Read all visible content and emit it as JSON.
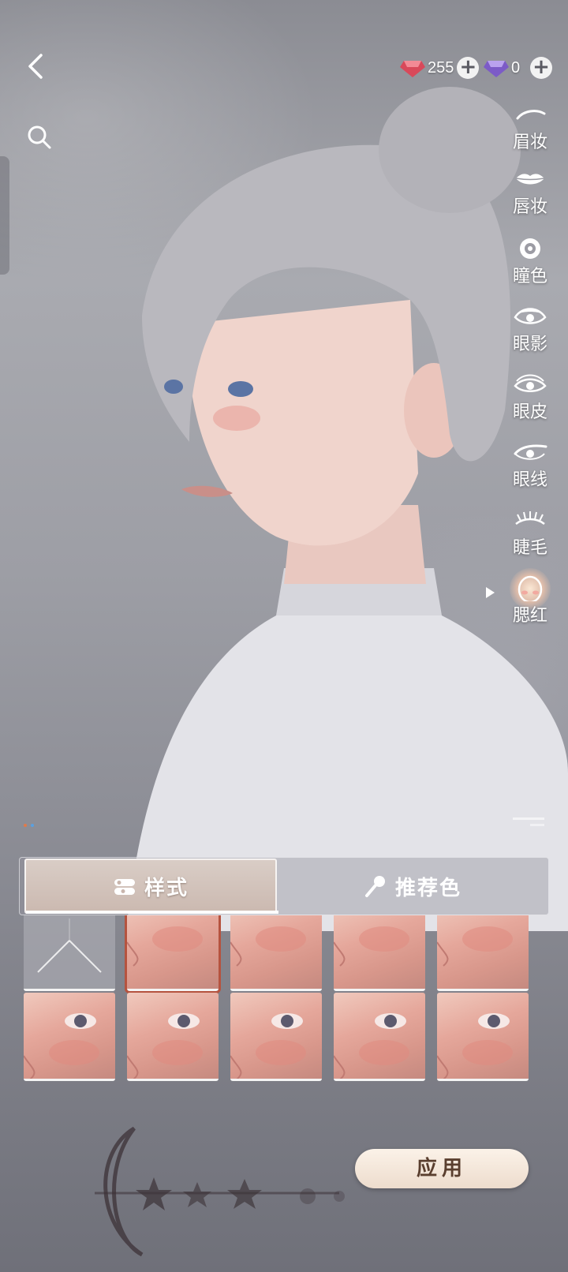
{
  "currency": {
    "red_gem_amount": "255",
    "purple_gem_amount": "0",
    "plus": "+"
  },
  "side_menu": {
    "items": [
      {
        "label": "眉妆",
        "icon": "eyebrow-icon"
      },
      {
        "label": "唇妆",
        "icon": "lips-icon"
      },
      {
        "label": "瞳色",
        "icon": "pupil-icon"
      },
      {
        "label": "眼影",
        "icon": "eyeshadow-icon"
      },
      {
        "label": "眼皮",
        "icon": "eyelid-icon"
      },
      {
        "label": "眼线",
        "icon": "eyeliner-icon"
      },
      {
        "label": "睫毛",
        "icon": "eyelash-icon"
      },
      {
        "label": "腮红",
        "icon": "blush-icon",
        "active": true
      }
    ]
  },
  "tabs": {
    "style_label": "样式",
    "color_label": "推荐色",
    "active": "style"
  },
  "grid": {
    "rows": 2,
    "columns": 5,
    "selected_index": 1
  },
  "apply_label": "应用",
  "colors": {
    "selected_outline": "#b5533f",
    "apply_text": "#5a3f2f",
    "active_tab_bg": "#d1c2ba"
  }
}
